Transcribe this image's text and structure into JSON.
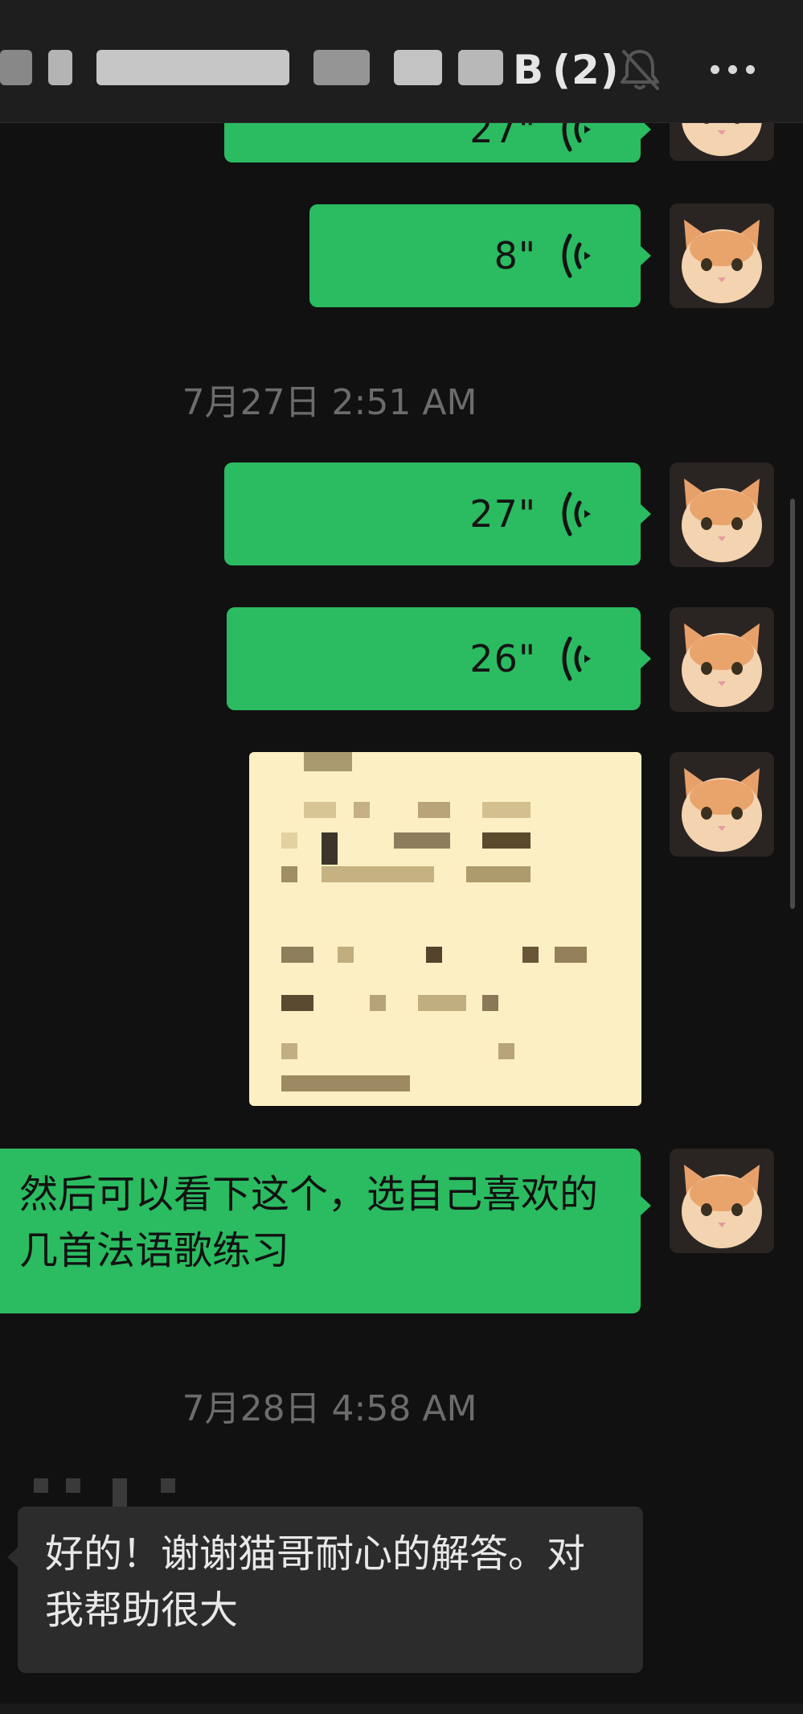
{
  "header": {
    "title_visible_suffix": "B",
    "unread_count": "(2)",
    "icons": [
      "mute-bell-icon",
      "more-options-icon"
    ]
  },
  "messages": [
    {
      "type": "voice",
      "direction": "outgoing",
      "duration": "27\"",
      "partially_visible": true
    },
    {
      "type": "voice",
      "direction": "outgoing",
      "duration": "8\""
    },
    {
      "type": "timestamp",
      "text": "7月27日 2:51 AM"
    },
    {
      "type": "voice",
      "direction": "outgoing",
      "duration": "27\""
    },
    {
      "type": "voice",
      "direction": "outgoing",
      "duration": "26\""
    },
    {
      "type": "image",
      "direction": "outgoing",
      "content": "pixelated-document"
    },
    {
      "type": "text",
      "direction": "outgoing",
      "text": "然后可以看下这个，选自己喜欢的几首法语歌练习"
    },
    {
      "type": "timestamp",
      "text": "7月28日 4:58 AM"
    },
    {
      "type": "text",
      "direction": "incoming",
      "text": "好的！谢谢猫哥耐心的解答。对我帮助很大"
    }
  ],
  "colors": {
    "background": "#111111",
    "header": "#1e1e1e",
    "outgoing_bubble": "#2bbb61",
    "incoming_bubble": "#2c2c2c",
    "timestamp_text": "#6c6c6c"
  }
}
